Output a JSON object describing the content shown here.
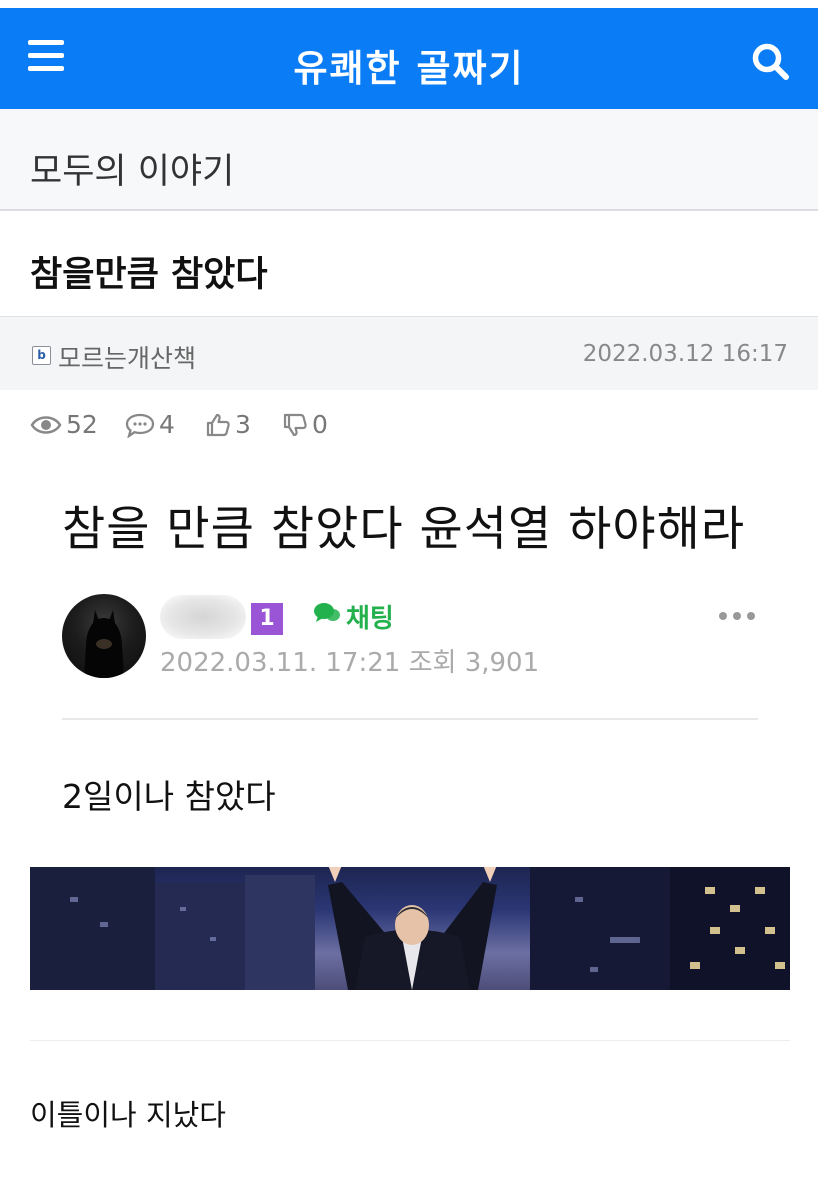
{
  "header": {
    "title": "유쾌한 골짜기",
    "menu_icon": "hamburger-menu-icon",
    "search_icon": "search-icon"
  },
  "board": {
    "name": "모두의 이야기"
  },
  "post": {
    "title": "참을만큼 참았다",
    "author_badge": "b",
    "author": "모르는개산책",
    "date": "2022.03.12 16:17",
    "stats": {
      "views": "52",
      "comments": "4",
      "likes": "3",
      "dislikes": "0"
    }
  },
  "content": {
    "headline": "참을 만큼 참았다 윤석열 하야해라",
    "cafe_post": {
      "level": "1",
      "chat_label": "채팅",
      "meta": "2022.03.11. 17:21  조회 3,901"
    },
    "body_line1": "2일이나 참았다",
    "body_line2": "이틀이나 지났다"
  },
  "colors": {
    "header_bg": "#0a7cf5",
    "level_badge": "#9a55d6",
    "chat_green": "#23b14d"
  }
}
